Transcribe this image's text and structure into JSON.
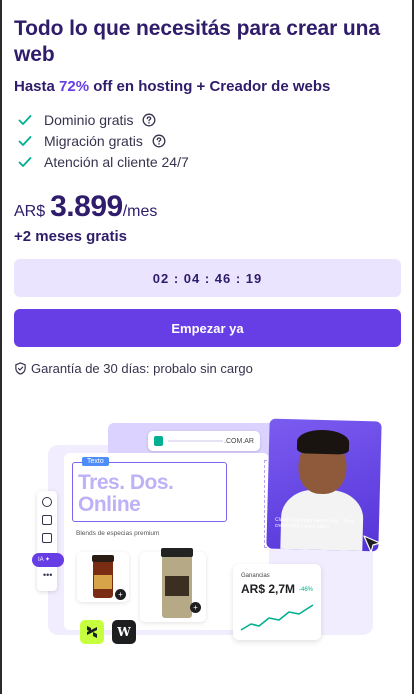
{
  "headline": "Todo lo que necesitás para crear una web",
  "subheadline": {
    "prefix": "Hasta ",
    "highlight": "72%",
    "suffix": " off en hosting + Creador de webs"
  },
  "features": [
    {
      "label": "Dominio gratis",
      "has_help": true
    },
    {
      "label": "Migración gratis",
      "has_help": true
    },
    {
      "label": "Atención al cliente 24/7",
      "has_help": false
    }
  ],
  "price": {
    "currency": "AR$",
    "amount": "3.899",
    "period": "/mes"
  },
  "bonus": "+2 meses gratis",
  "timer": "02 : 04 : 46 : 19",
  "cta_label": "Empezar ya",
  "guarantee": "Garantía de 30 días: probalo sin cargo",
  "illustration": {
    "url_suffix": ".COM.AR",
    "text_tag": "Texto",
    "site_title": "Tres. Dos. Online",
    "products_label": "Blends de especias premium",
    "ia_label": "IA",
    "photo_caption": "Claude Santiago Valenzuela... Pura creatividad y buen sabor",
    "earnings_label": "Ganancias",
    "earnings_value": "AR$ 2,7M",
    "earnings_change": "-46%"
  },
  "colors": {
    "accent": "#673de6",
    "heading": "#2f1c6a",
    "check": "#00b090",
    "timer_bg": "#ebe4ff"
  }
}
